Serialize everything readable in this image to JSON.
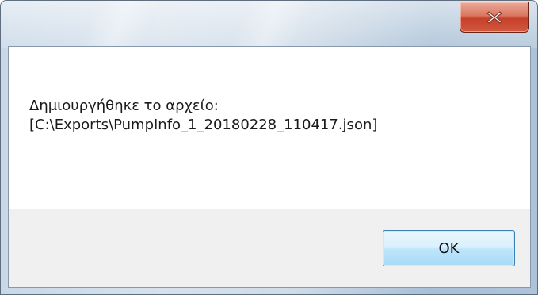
{
  "window": {
    "title": "",
    "close_icon": "close-icon"
  },
  "message": {
    "text": "Δημιουργήθηκε το αρχείο:\n[C:\\Exports\\PumpInfo_1_20180228_110417.json]"
  },
  "buttons": {
    "ok_label": "OK"
  },
  "colors": {
    "close_button": "#c7402a",
    "ok_border": "#3c7fb1",
    "button_panel": "#f0f0f0"
  }
}
